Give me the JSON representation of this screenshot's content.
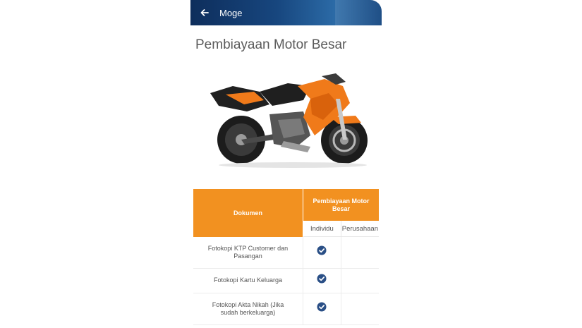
{
  "appbar": {
    "title": "Moge",
    "back_icon": "arrow-left-icon"
  },
  "page": {
    "title": "Pembiayaan Motor Besar"
  },
  "colors": {
    "appbar": "#17467e",
    "table_header": "#f29120",
    "check": "#2a4f86",
    "bike_orange": "#f07a1a"
  },
  "table": {
    "doc_header": "Dokumen",
    "group_header": "Pembiayaan Motor Besar",
    "sub_headers": [
      "Individu",
      "Perusahaan"
    ],
    "rows": [
      {
        "label": "Fotokopi KTP Customer dan Pasangan",
        "individu": true,
        "perusahaan": false
      },
      {
        "label": "Fotokopi Kartu Keluarga",
        "individu": true,
        "perusahaan": false
      },
      {
        "label": "Fotokopi Akta Nikah (Jika sudah berkeluarga)",
        "individu": true,
        "perusahaan": false
      }
    ]
  }
}
